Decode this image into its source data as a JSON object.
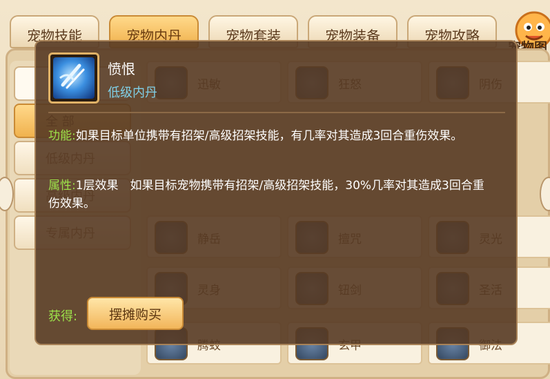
{
  "tabs": [
    {
      "label": "宠物技能",
      "active": false
    },
    {
      "label": "宠物内丹",
      "active": true
    },
    {
      "label": "宠物套装",
      "active": false
    },
    {
      "label": "宠物装备",
      "active": false
    },
    {
      "label": "宠物攻略",
      "active": false
    }
  ],
  "header_right": {
    "label": "宠物图"
  },
  "sidebar": {
    "items": [
      {
        "label": ""
      },
      {
        "label": "全 部"
      },
      {
        "label": "低级内丹"
      },
      {
        "label": "高级内丹"
      },
      {
        "label": "专属内丹"
      }
    ]
  },
  "grid": [
    {
      "name": "迅敏"
    },
    {
      "name": "狂怒"
    },
    {
      "name": "阴伤"
    },
    {
      "name": "静岳"
    },
    {
      "name": "擅咒"
    },
    {
      "name": "灵光"
    },
    {
      "name": "灵身"
    },
    {
      "name": "钮剑"
    },
    {
      "name": "圣活"
    },
    {
      "name": "腾蛟"
    },
    {
      "name": "玄甲"
    },
    {
      "name": "御法"
    }
  ],
  "tooltip": {
    "title": "愤恨",
    "subtitle": "低级内丹",
    "function_label": "功能:",
    "function_text": "如果目标单位携带有招架/高级招架技能，有几率对其造成3回合重伤效果。",
    "attribute_label": "属性:",
    "attribute_text": "1层效果　如果目标宠物携带有招架/高级招架技能，30%几率对其造成3回合重伤效果。",
    "obtain_label": "获得:",
    "buy_button": "摆摊购买"
  }
}
